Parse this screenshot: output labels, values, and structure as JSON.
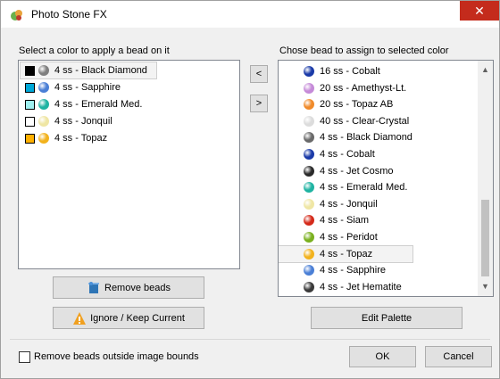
{
  "window": {
    "title": "Photo Stone FX",
    "close_glyph": "✕"
  },
  "left_panel": {
    "label": "Select a color to apply a bead on it",
    "items": [
      {
        "swatch": "#000000",
        "bead": "#7f7f7f",
        "label": "4 ss - Black Diamond"
      },
      {
        "swatch": "#00a8d8",
        "bead": "#4a7fd6",
        "label": "4 ss - Sapphire"
      },
      {
        "swatch": "#9ff0f0",
        "bead": "#1fb3a2",
        "label": "4 ss - Emerald Med."
      },
      {
        "swatch": "#ffffff",
        "bead": "#efe6a4",
        "label": "4 ss - Jonquil"
      },
      {
        "swatch": "#ffb000",
        "bead": "#f2b21c",
        "label": "4 ss - Topaz"
      }
    ]
  },
  "arrows": {
    "left": "<",
    "right": ">"
  },
  "right_panel": {
    "label": "Chose bead to assign to selected color",
    "items": [
      {
        "bead": "#1a3aa8",
        "label": "16 ss - Cobalt"
      },
      {
        "bead": "#c58ad8",
        "label": "20 ss - Amethyst-Lt."
      },
      {
        "bead": "#f08a2a",
        "label": "20 ss - Topaz AB"
      },
      {
        "bead": "#dcdcdc",
        "label": "40 ss - Clear-Crystal"
      },
      {
        "bead": "#6a6a6a",
        "label": "4 ss - Black Diamond"
      },
      {
        "bead": "#1a3aa8",
        "label": "4 ss - Cobalt"
      },
      {
        "bead": "#2a2a2a",
        "label": "4 ss - Jet Cosmo"
      },
      {
        "bead": "#1fb3a2",
        "label": "4 ss - Emerald Med."
      },
      {
        "bead": "#efe6a4",
        "label": "4 ss - Jonquil"
      },
      {
        "bead": "#d42a1a",
        "label": "4 ss - Siam"
      },
      {
        "bead": "#7ab01f",
        "label": "4 ss - Peridot"
      },
      {
        "bead": "#f2b21c",
        "label": "4 ss - Topaz"
      },
      {
        "bead": "#4a7fd6",
        "label": "4 ss - Sapphire"
      },
      {
        "bead": "#3a3a3a",
        "label": "4 ss - Jet Hematite"
      }
    ],
    "selected_index": 11
  },
  "buttons": {
    "remove_beads": "Remove beads",
    "ignore_keep": "Ignore / Keep Current",
    "edit_palette": "Edit Palette",
    "ok": "OK",
    "cancel": "Cancel"
  },
  "checkbox": {
    "label": "Remove beads outside image bounds",
    "checked": false
  }
}
